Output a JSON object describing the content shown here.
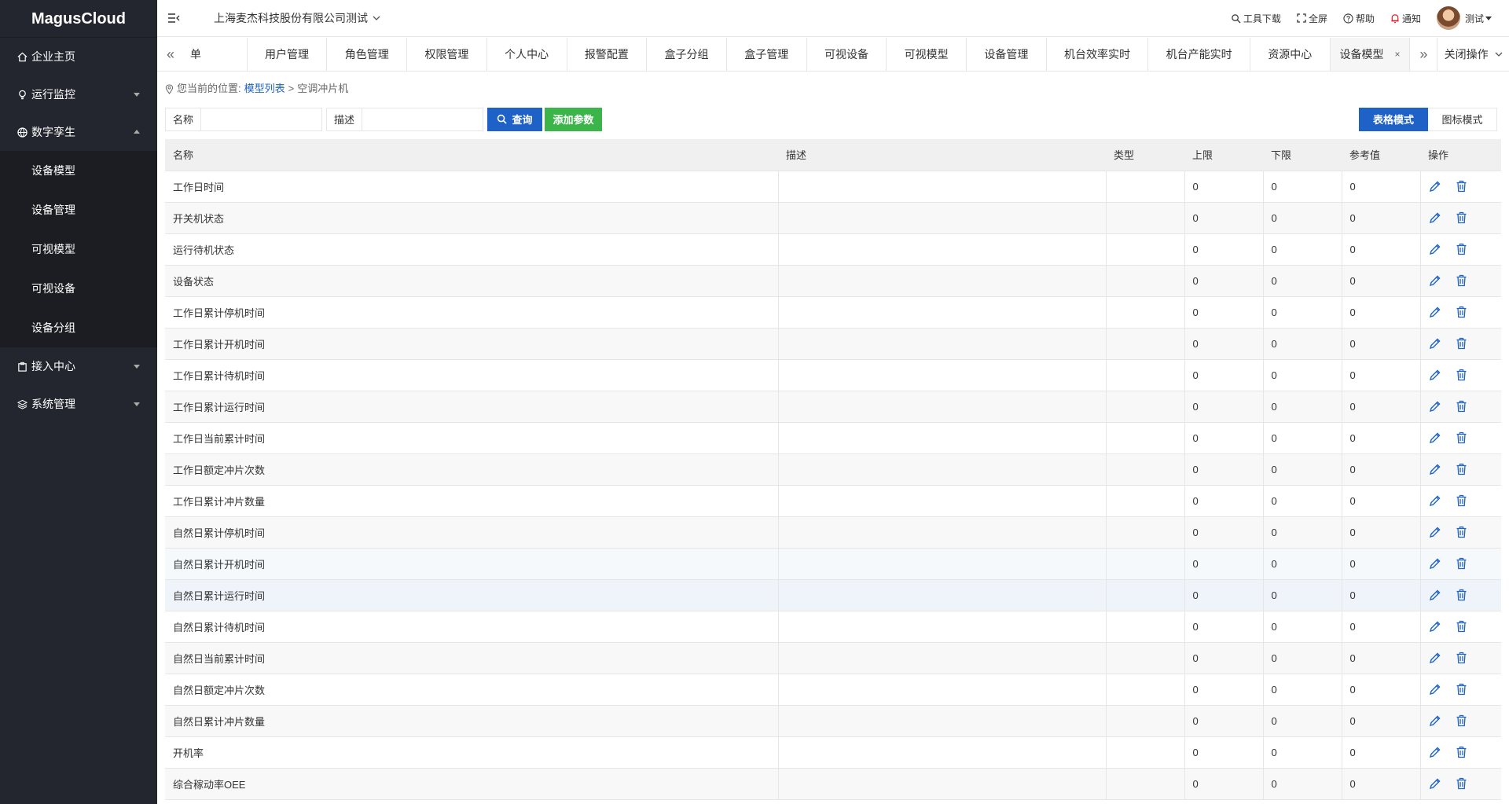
{
  "app": {
    "logo": "MagusCloud",
    "company": "上海麦杰科技股份有限公司测试"
  },
  "header": {
    "tools_download": "工具下载",
    "fullscreen": "全屏",
    "help": "帮助",
    "notify": "通知",
    "user": "测试"
  },
  "sidebar": {
    "items": [
      {
        "label": "企业主页",
        "icon": "home-icon"
      },
      {
        "label": "运行监控",
        "icon": "bulb-icon"
      },
      {
        "label": "数字孪生",
        "icon": "globe-icon"
      },
      {
        "label": "接入中心",
        "icon": "clipboard-icon"
      },
      {
        "label": "系统管理",
        "icon": "layers-icon"
      }
    ],
    "submenu": [
      "设备模型",
      "设备管理",
      "可视模型",
      "可视设备",
      "设备分组"
    ]
  },
  "tabs": {
    "items": [
      "菜单",
      "用户管理",
      "角色管理",
      "权限管理",
      "个人中心",
      "报警配置",
      "盒子分组",
      "盒子管理",
      "可视设备",
      "可视模型",
      "设备管理",
      "机台效率实时",
      "机台产能实时",
      "资源中心",
      "设备模型"
    ],
    "first_visible": "单",
    "active_close": "×",
    "close_ops": "关闭操作"
  },
  "breadcrumb": {
    "prefix": "您当前的位置:",
    "link": "模型列表",
    "sep": ">",
    "current": "空调冲片机"
  },
  "filters": {
    "name_label": "名称",
    "desc_label": "描述",
    "query_btn": "查询",
    "add_btn": "添加参数",
    "mode_table": "表格模式",
    "mode_icon": "图标模式"
  },
  "table": {
    "headers": [
      "名称",
      "描述",
      "类型",
      "上限",
      "下限",
      "参考值",
      "操作"
    ],
    "rows": [
      {
        "name": "工作日时间",
        "desc": "",
        "type": "",
        "upper": "0",
        "lower": "0",
        "ref": "0"
      },
      {
        "name": "开关机状态",
        "desc": "",
        "type": "",
        "upper": "0",
        "lower": "0",
        "ref": "0"
      },
      {
        "name": "运行待机状态",
        "desc": "",
        "type": "",
        "upper": "0",
        "lower": "0",
        "ref": "0"
      },
      {
        "name": "设备状态",
        "desc": "",
        "type": "",
        "upper": "0",
        "lower": "0",
        "ref": "0"
      },
      {
        "name": "工作日累计停机时间",
        "desc": "",
        "type": "",
        "upper": "0",
        "lower": "0",
        "ref": "0"
      },
      {
        "name": "工作日累计开机时间",
        "desc": "",
        "type": "",
        "upper": "0",
        "lower": "0",
        "ref": "0"
      },
      {
        "name": "工作日累计待机时间",
        "desc": "",
        "type": "",
        "upper": "0",
        "lower": "0",
        "ref": "0"
      },
      {
        "name": "工作日累计运行时间",
        "desc": "",
        "type": "",
        "upper": "0",
        "lower": "0",
        "ref": "0"
      },
      {
        "name": "工作日当前累计时间",
        "desc": "",
        "type": "",
        "upper": "0",
        "lower": "0",
        "ref": "0"
      },
      {
        "name": "工作日额定冲片次数",
        "desc": "",
        "type": "",
        "upper": "0",
        "lower": "0",
        "ref": "0"
      },
      {
        "name": "工作日累计冲片数量",
        "desc": "",
        "type": "",
        "upper": "0",
        "lower": "0",
        "ref": "0"
      },
      {
        "name": "自然日累计停机时间",
        "desc": "",
        "type": "",
        "upper": "0",
        "lower": "0",
        "ref": "0"
      },
      {
        "name": "自然日累计开机时间",
        "desc": "",
        "type": "",
        "upper": "0",
        "lower": "0",
        "ref": "0"
      },
      {
        "name": "自然日累计运行时间",
        "desc": "",
        "type": "",
        "upper": "0",
        "lower": "0",
        "ref": "0"
      },
      {
        "name": "自然日累计待机时间",
        "desc": "",
        "type": "",
        "upper": "0",
        "lower": "0",
        "ref": "0"
      },
      {
        "name": "自然日当前累计时间",
        "desc": "",
        "type": "",
        "upper": "0",
        "lower": "0",
        "ref": "0"
      },
      {
        "name": "自然日额定冲片次数",
        "desc": "",
        "type": "",
        "upper": "0",
        "lower": "0",
        "ref": "0"
      },
      {
        "name": "自然日累计冲片数量",
        "desc": "",
        "type": "",
        "upper": "0",
        "lower": "0",
        "ref": "0"
      },
      {
        "name": "开机率",
        "desc": "",
        "type": "",
        "upper": "0",
        "lower": "0",
        "ref": "0"
      },
      {
        "name": "综合稼动率OEE",
        "desc": "",
        "type": "",
        "upper": "0",
        "lower": "0",
        "ref": "0"
      }
    ]
  },
  "colors": {
    "sidebar_bg": "#23262e",
    "primary": "#1e62c8",
    "success": "#3bb54a",
    "notify": "#e02020"
  }
}
